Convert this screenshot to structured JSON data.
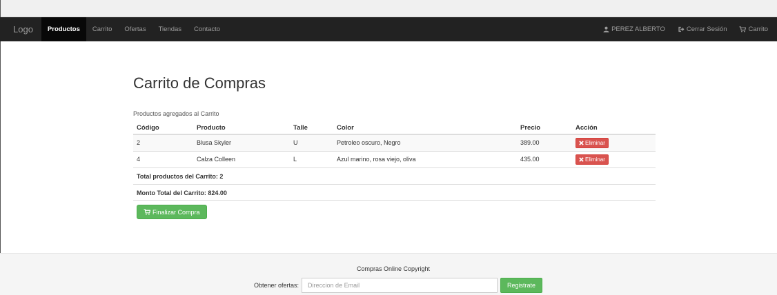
{
  "navbar": {
    "brand": "Logo",
    "links": [
      {
        "label": "Productos",
        "active": true
      },
      {
        "label": "Carrito"
      },
      {
        "label": "Ofertas"
      },
      {
        "label": "Tiendas"
      },
      {
        "label": "Contacto"
      }
    ],
    "right": {
      "user": {
        "label": "PEREZ ALBERTO",
        "icon": "user-icon"
      },
      "logout": {
        "label": "Cerrar Sesión",
        "icon": "logout-icon"
      },
      "cart": {
        "label": "Carrito",
        "icon": "cart-icon"
      }
    }
  },
  "main": {
    "title": "Carrito de Compras",
    "caption": "Productos agregados al Carrito",
    "table": {
      "headers": [
        "Código",
        "Producto",
        "Talle",
        "Color",
        "Precio",
        "Acción"
      ],
      "rows": [
        {
          "codigo": "2",
          "producto": "Blusa Skyler",
          "talle": "U",
          "color": "Petroleo oscuro, Negro",
          "precio": "389.00",
          "accion": "Eliminar"
        },
        {
          "codigo": "4",
          "producto": "Calza Colleen",
          "talle": "L",
          "color": "Azul marino, rosa viejo, oliva",
          "precio": "435.00",
          "accion": "Eliminar"
        }
      ]
    },
    "total_products": "Total productos del Carrito: 2",
    "total_amount": "Monto Total del Carrito: 824.00",
    "checkout_label": "Finalizar Compra"
  },
  "footer": {
    "title": "Compras Online Copyright",
    "form_label": "Obtener ofertas:",
    "email_placeholder": "Direccion de Email",
    "register_label": "Registrate"
  },
  "colors": {
    "navbar_bg": "#222222",
    "danger": "#d9534f",
    "success": "#5cb85c"
  }
}
